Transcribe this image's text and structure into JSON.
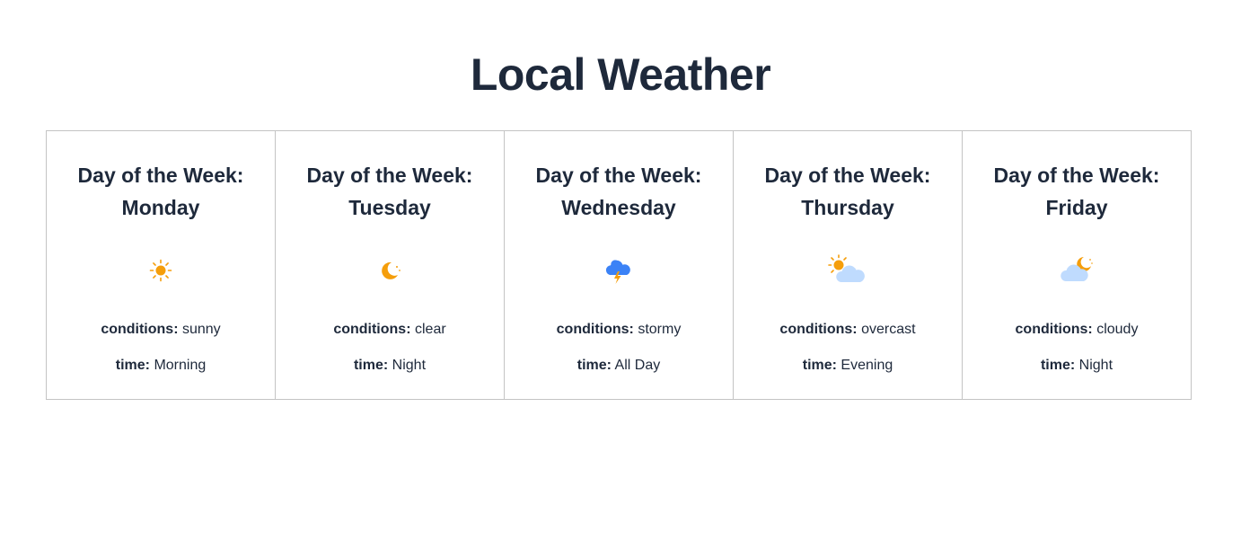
{
  "page": {
    "title": "Local Weather"
  },
  "labels": {
    "conditions": "conditions:",
    "time": "time:"
  },
  "colors": {
    "text": "#1e293b",
    "sun": "#f59e0b",
    "cloud_light": "#bfdbfe",
    "cloud_blue": "#3b82f6",
    "border": "#c4c4c4"
  },
  "days": [
    {
      "heading_line1": "Day of the Week:",
      "heading_line2": "Monday",
      "icon": "sun-icon",
      "conditions": "sunny",
      "time": "Morning"
    },
    {
      "heading_line1": "Day of the Week:",
      "heading_line2": "Tuesday",
      "icon": "moon-icon",
      "conditions": "clear",
      "time": "Night"
    },
    {
      "heading_line1": "Day of the Week:",
      "heading_line2": "Wednesday",
      "icon": "thunderstorm-icon",
      "conditions": "stormy",
      "time": "All Day"
    },
    {
      "heading_line1": "Day of the Week:",
      "heading_line2": "Thursday",
      "icon": "sun-behind-cloud-icon",
      "conditions": "overcast",
      "time": "Evening"
    },
    {
      "heading_line1": "Day of the Week:",
      "heading_line2": "Friday",
      "icon": "moon-behind-cloud-icon",
      "conditions": "cloudy",
      "time": "Night"
    }
  ]
}
